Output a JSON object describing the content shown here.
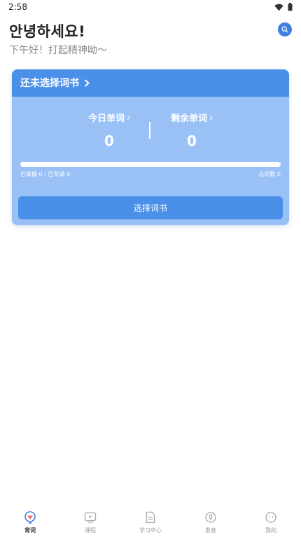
{
  "status_bar": {
    "time": "2:58"
  },
  "header": {
    "title": "안녕하세요!",
    "subtitle": "下午好！打起精神呦～"
  },
  "card": {
    "header_label": "还未选择词书",
    "today": {
      "label": "今日单词",
      "value": "0"
    },
    "remaining": {
      "label": "剩余单词",
      "value": "0"
    },
    "progress": {
      "fraction": 0,
      "left_text": "已掌握 0 / 已背诵 0",
      "right_text": "总词数 0"
    },
    "button_label": "选择词书"
  },
  "nav": {
    "items": [
      {
        "label": "背词",
        "icon": "vocab-icon",
        "active": true
      },
      {
        "label": "课程",
        "icon": "course-icon",
        "active": false
      },
      {
        "label": "学习中心",
        "icon": "study-center-icon",
        "active": false
      },
      {
        "label": "发音",
        "icon": "pronunciation-icon",
        "active": false
      },
      {
        "label": "我的",
        "icon": "profile-icon",
        "active": false
      }
    ]
  },
  "colors": {
    "accent": "#4a90e8",
    "card_body": "#99c1f6",
    "muted_text": "#8a8a8a"
  }
}
